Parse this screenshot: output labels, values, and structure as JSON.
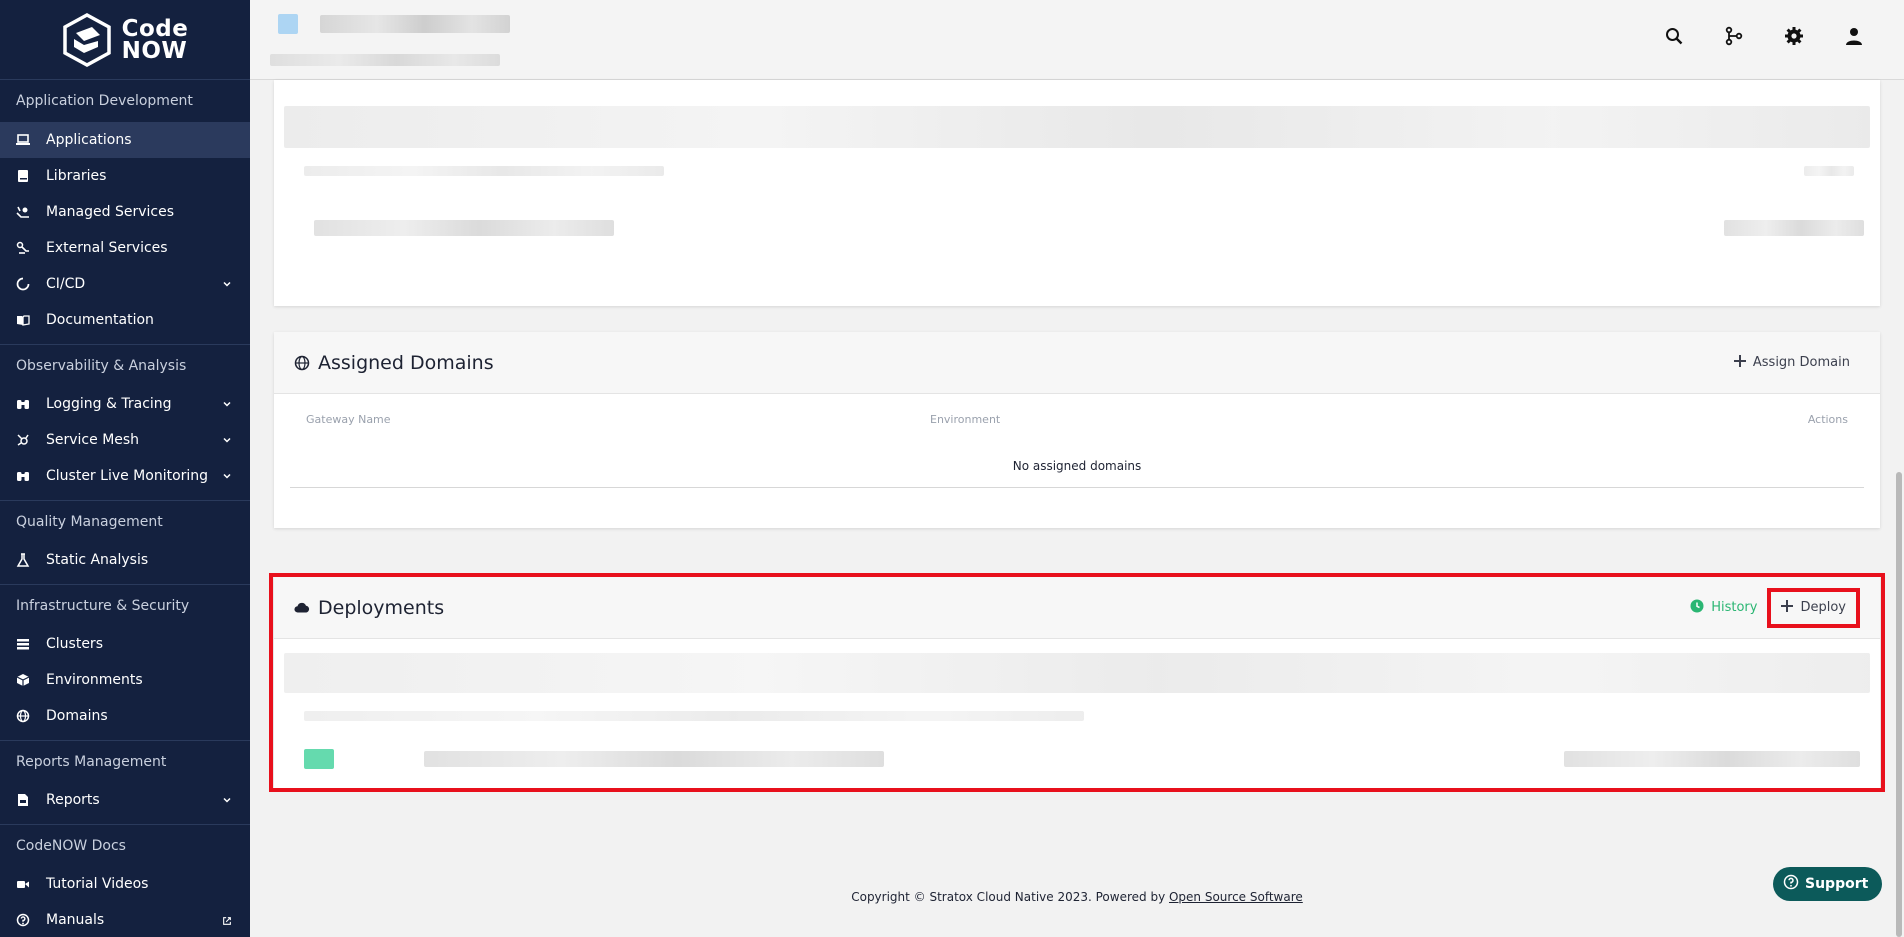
{
  "brand": {
    "line1": "Code",
    "line2": "NOW"
  },
  "sidebar": {
    "sections": [
      {
        "title": "Application Development"
      },
      {
        "title": "Observability & Analysis"
      },
      {
        "title": "Quality Management"
      },
      {
        "title": "Infrastructure & Security"
      },
      {
        "title": "Reports Management"
      },
      {
        "title": "CodeNOW Docs"
      }
    ],
    "items": {
      "applications": "Applications",
      "libraries": "Libraries",
      "managed_services": "Managed Services",
      "external_services": "External Services",
      "cicd": "CI/CD",
      "documentation": "Documentation",
      "logging": "Logging & Tracing",
      "service_mesh": "Service Mesh",
      "cluster_monitoring": "Cluster Live Monitoring",
      "static_analysis": "Static Analysis",
      "clusters": "Clusters",
      "environments": "Environments",
      "domains": "Domains",
      "reports": "Reports",
      "tutorial_videos": "Tutorial Videos",
      "manuals": "Manuals"
    }
  },
  "topbar": {
    "icons": [
      "search-icon",
      "git-branch-icon",
      "gear-icon",
      "user-icon"
    ]
  },
  "domains_card": {
    "title": "Assigned Domains",
    "assign_label": "Assign Domain",
    "columns": [
      "Gateway Name",
      "Environment",
      "Actions"
    ],
    "empty_text": "No assigned domains"
  },
  "deployments_card": {
    "title": "Deployments",
    "history_label": "History",
    "deploy_label": "Deploy"
  },
  "footer": {
    "text": "Copyright © Stratox Cloud Native 2023. Powered by ",
    "link": "Open Source Software"
  },
  "support": {
    "label": "Support"
  },
  "colors": {
    "sidebar": "#14213f",
    "accent_green": "#2bb673",
    "highlight": "#e8101c",
    "support": "#0c5a5a"
  }
}
